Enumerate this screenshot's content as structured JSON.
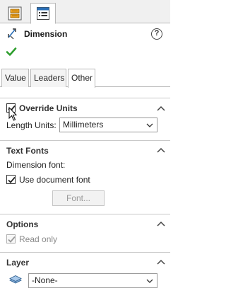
{
  "top_tabs": {
    "tab1_icon": "feature-manager-icon",
    "tab2_icon": "property-manager-icon"
  },
  "header": {
    "title": "Dimension",
    "help_icon_glyph": "?"
  },
  "prop_tabs": [
    "Value",
    "Leaders",
    "Other"
  ],
  "override_units": {
    "title": "Override Units",
    "checked": true,
    "length_units_label": "Length Units:",
    "length_units_value": "Millimeters"
  },
  "text_fonts": {
    "title": "Text Fonts",
    "dimension_font_label": "Dimension font:",
    "use_document_font_label": "Use document font",
    "use_document_font_checked": true,
    "font_button_label": "Font..."
  },
  "options": {
    "title": "Options",
    "read_only_label": "Read only",
    "read_only_checked": true
  },
  "layer": {
    "title": "Layer",
    "value": "-None-"
  },
  "colors": {
    "ok_green": "#2e9e2e",
    "accent_blue": "#2b6fb6"
  }
}
